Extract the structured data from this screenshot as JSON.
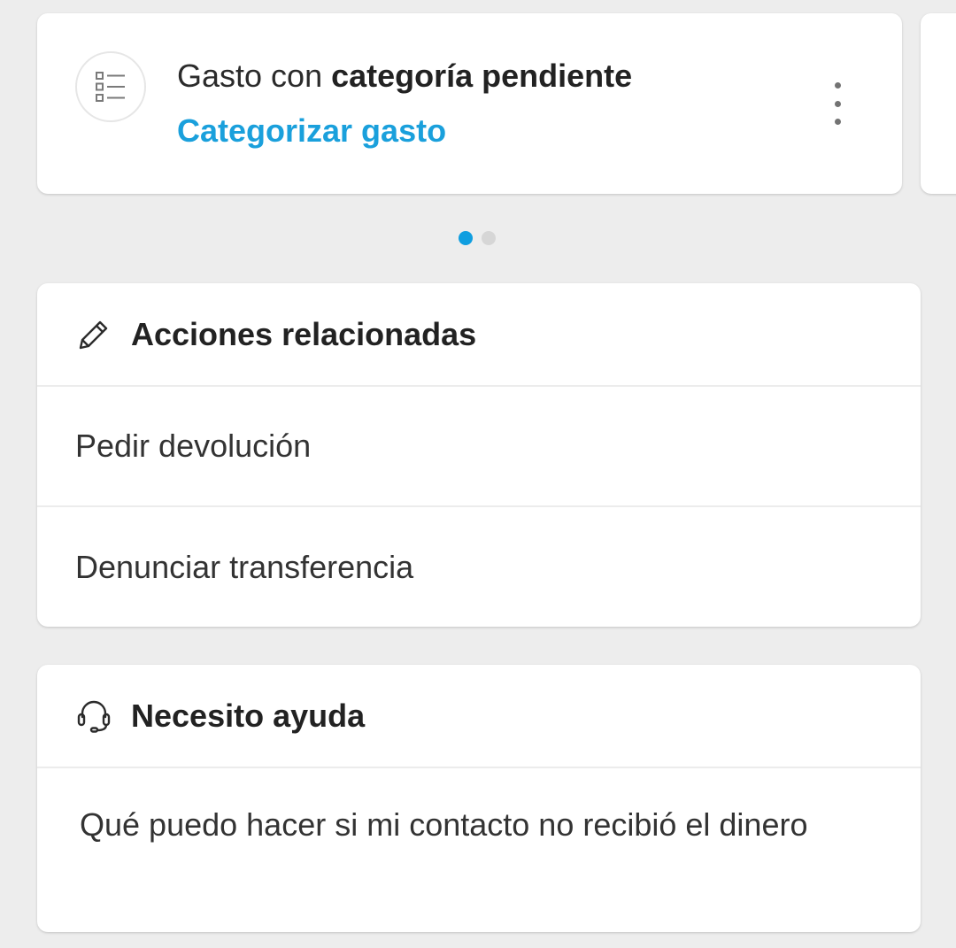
{
  "notification": {
    "title_prefix": "Gasto con ",
    "title_bold": "categoría pendiente",
    "action_label": "Categorizar gasto",
    "icon": "list-icon",
    "menu_icon": "more-vert-icon"
  },
  "carousel": {
    "page_count": 2,
    "active_index": 0
  },
  "related_actions": {
    "title": "Acciones relacionadas",
    "icon": "pencil-icon",
    "items": [
      {
        "label": "Pedir devolución"
      },
      {
        "label": "Denunciar transferencia"
      }
    ]
  },
  "help": {
    "title": "Necesito ayuda",
    "icon": "headset-icon",
    "items": [
      {
        "label": "Qué puedo hacer si mi contacto no recibió el dinero"
      }
    ]
  },
  "colors": {
    "accent": "#1aa0dc",
    "background": "#ededed",
    "card": "#ffffff",
    "dot_inactive": "#d6d6d6"
  }
}
